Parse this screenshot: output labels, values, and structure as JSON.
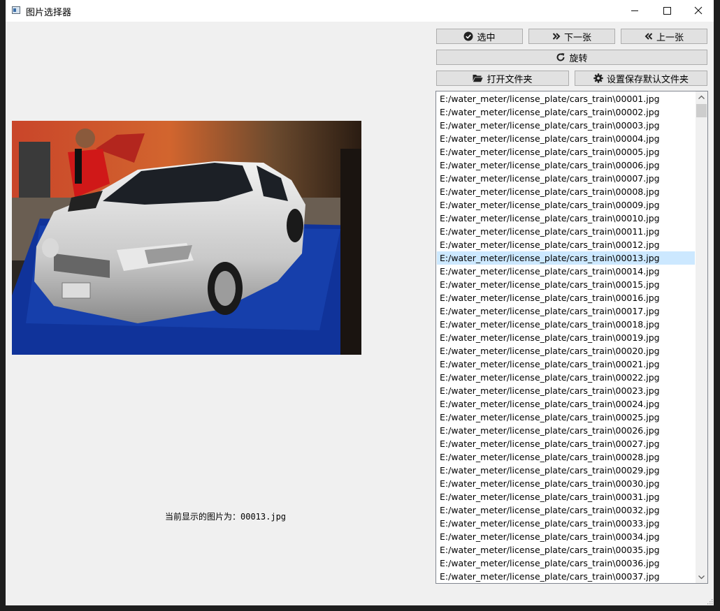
{
  "window": {
    "title": "图片选择器"
  },
  "window_controls": {
    "minimize": "—",
    "maximize": "☐",
    "close": "✕"
  },
  "toolbar": {
    "select_label": "选中",
    "next_label": "下一张",
    "prev_label": "上一张",
    "rotate_label": "旋转",
    "open_folder_label": "打开文件夹",
    "set_default_label": "设置保存默认文件夹"
  },
  "status": {
    "text": "当前显示的图片为：00013.jpg"
  },
  "file_list": {
    "selected_index": 12,
    "items": [
      "E:/water_meter/license_plate/cars_train\\00001.jpg",
      "E:/water_meter/license_plate/cars_train\\00002.jpg",
      "E:/water_meter/license_plate/cars_train\\00003.jpg",
      "E:/water_meter/license_plate/cars_train\\00004.jpg",
      "E:/water_meter/license_plate/cars_train\\00005.jpg",
      "E:/water_meter/license_plate/cars_train\\00006.jpg",
      "E:/water_meter/license_plate/cars_train\\00007.jpg",
      "E:/water_meter/license_plate/cars_train\\00008.jpg",
      "E:/water_meter/license_plate/cars_train\\00009.jpg",
      "E:/water_meter/license_plate/cars_train\\00010.jpg",
      "E:/water_meter/license_plate/cars_train\\00011.jpg",
      "E:/water_meter/license_plate/cars_train\\00012.jpg",
      "E:/water_meter/license_plate/cars_train\\00013.jpg",
      "E:/water_meter/license_plate/cars_train\\00014.jpg",
      "E:/water_meter/license_plate/cars_train\\00015.jpg",
      "E:/water_meter/license_plate/cars_train\\00016.jpg",
      "E:/water_meter/license_plate/cars_train\\00017.jpg",
      "E:/water_meter/license_plate/cars_train\\00018.jpg",
      "E:/water_meter/license_plate/cars_train\\00019.jpg",
      "E:/water_meter/license_plate/cars_train\\00020.jpg",
      "E:/water_meter/license_plate/cars_train\\00021.jpg",
      "E:/water_meter/license_plate/cars_train\\00022.jpg",
      "E:/water_meter/license_plate/cars_train\\00023.jpg",
      "E:/water_meter/license_plate/cars_train\\00024.jpg",
      "E:/water_meter/license_plate/cars_train\\00025.jpg",
      "E:/water_meter/license_plate/cars_train\\00026.jpg",
      "E:/water_meter/license_plate/cars_train\\00027.jpg",
      "E:/water_meter/license_plate/cars_train\\00028.jpg",
      "E:/water_meter/license_plate/cars_train\\00029.jpg",
      "E:/water_meter/license_plate/cars_train\\00030.jpg",
      "E:/water_meter/license_plate/cars_train\\00031.jpg",
      "E:/water_meter/license_plate/cars_train\\00032.jpg",
      "E:/water_meter/license_plate/cars_train\\00033.jpg",
      "E:/water_meter/license_plate/cars_train\\00034.jpg",
      "E:/water_meter/license_plate/cars_train\\00035.jpg",
      "E:/water_meter/license_plate/cars_train\\00036.jpg",
      "E:/water_meter/license_plate/cars_train\\00037.jpg"
    ]
  },
  "colors": {
    "window_bg": "#f0f0f0",
    "selection_bg": "#cce8ff",
    "button_bg": "#e1e1e1",
    "button_border": "#adadad"
  }
}
